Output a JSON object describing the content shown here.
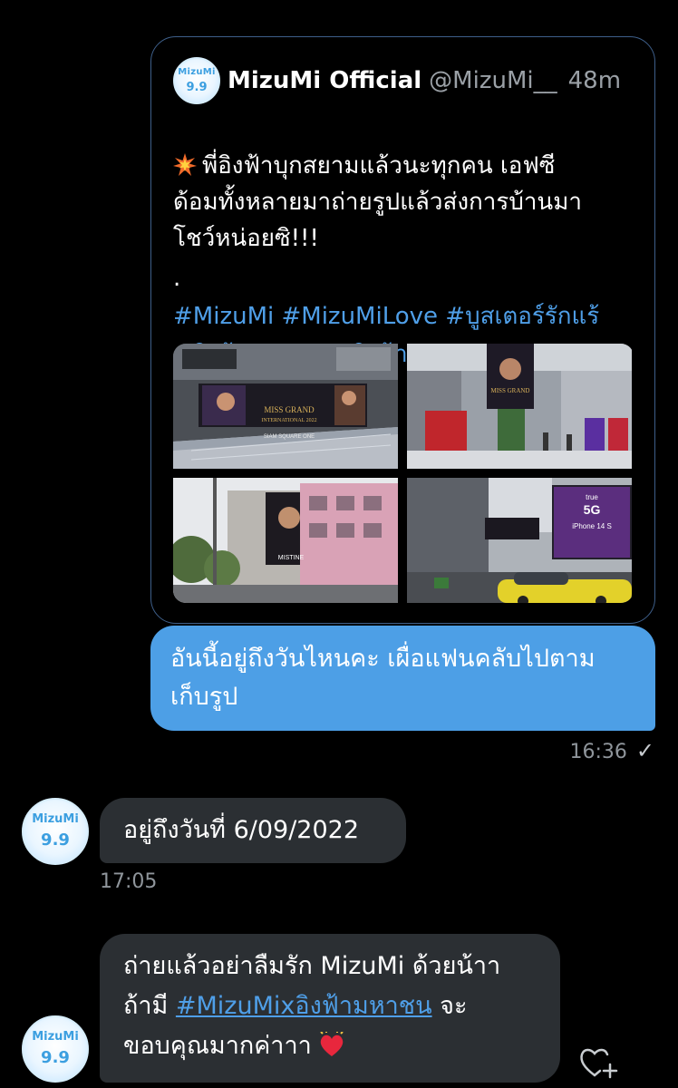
{
  "quoted_tweet": {
    "avatar_line1": "MizuMi",
    "avatar_line2": "9.9",
    "name": "MizuMi Official",
    "handle": "@MizuMi__",
    "time": "48m",
    "text_line1": "พี่อิงฟ้าบุกสยามแล้วนะทุกคน เอฟซี",
    "text_line2": "ด้อมทั้งหลายมาถ่ายรูปแล้วส่งการบ้านมา",
    "text_line3": "โชว์หน่อยซิ!!!",
    "dot": ".",
    "tags_line1": "#MizuMi #MizuMiLove #บูสเตอร์รักแร้",
    "tags_line2": "#อิงฟ้ามหาชน #อิงฟ้า",
    "photo_billboard_title": "MISS GRAND",
    "photo_billboard_sub": "INTERNATIONAL 2022",
    "photo_sign": "SIAM SQUARE ONE",
    "photo_brand": "MISTINE",
    "photo_ad_brand": "true",
    "photo_ad_5g": "5G",
    "photo_ad_phone": "iPhone 14 S"
  },
  "sent_message": {
    "line1": "อันนี้อยู่ถึงวันไหนคะ เผื่อแฟนคลับไปตาม",
    "line2": "เก็บรูป",
    "time": "16:36",
    "status_icon": "✓"
  },
  "reply1": {
    "avatar_line1": "MizuMi",
    "avatar_line2": "9.9",
    "text": "อยู่ถึงวันที่ 6/09/2022",
    "time": "17:05"
  },
  "reply2": {
    "avatar_line1": "MizuMi",
    "avatar_line2": "9.9",
    "line1": "ถ่ายแล้วอย่าลืมรัก MizuMi ด้วยน้าา",
    "line2_prefix": "ถ้ามี ",
    "link": "#MizuMixอิงฟ้ามหาชน",
    "line2_suffix": " จะ",
    "line3": "ขอบคุณมากค่าาา"
  },
  "colors": {
    "background": "#000000",
    "sent_bubble": "#4d9fe6",
    "received_bubble": "#2b2f33",
    "link": "#4f9fe8",
    "muted": "#8f959b"
  }
}
